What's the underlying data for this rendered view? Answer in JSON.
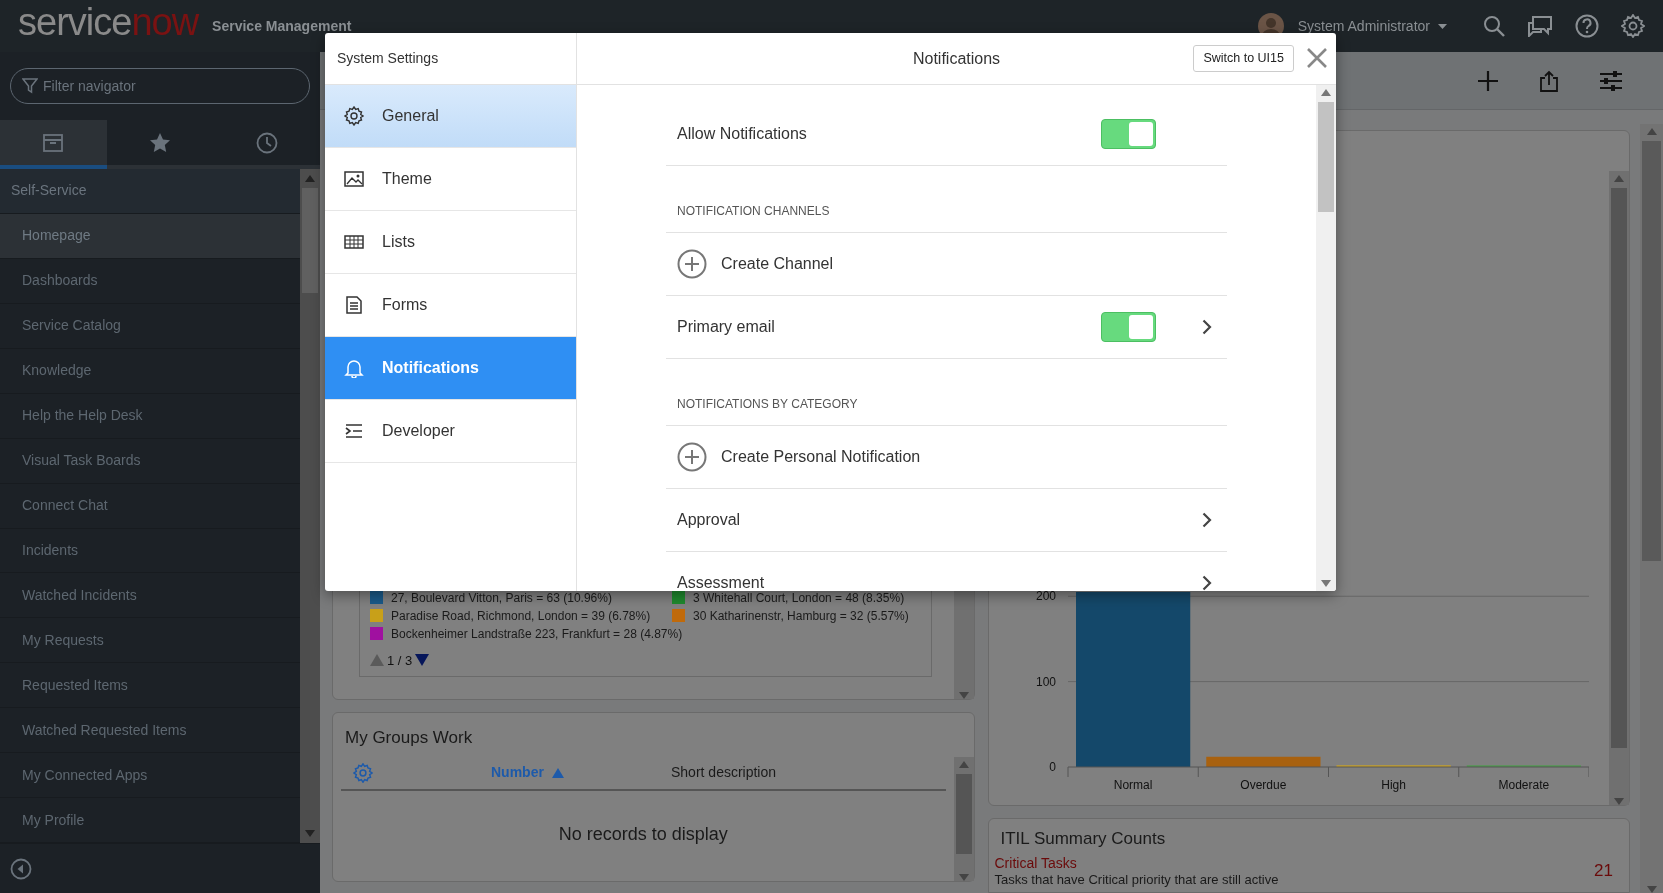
{
  "header": {
    "logo": {
      "text": "service",
      "accent": "now"
    },
    "product": "Service Management",
    "user": "System Administrator"
  },
  "navigator": {
    "filter": {
      "placeholder": "Filter navigator"
    },
    "tabs": [
      {
        "kind": "all",
        "selected": true
      },
      {
        "kind": "favorites",
        "selected": false
      },
      {
        "kind": "history",
        "selected": false
      }
    ],
    "section": "Self-Service",
    "items": [
      {
        "label": "Homepage",
        "selected": true
      },
      {
        "label": "Dashboards",
        "selected": false
      },
      {
        "label": "Service Catalog",
        "selected": false
      },
      {
        "label": "Knowledge",
        "selected": false
      },
      {
        "label": "Help the Help Desk",
        "selected": false
      },
      {
        "label": "Visual Task Boards",
        "selected": false
      },
      {
        "label": "Connect Chat",
        "selected": false
      },
      {
        "label": "Incidents",
        "selected": false
      },
      {
        "label": "Watched Incidents",
        "selected": false
      },
      {
        "label": "My Requests",
        "selected": false
      },
      {
        "label": "Requested Items",
        "selected": false
      },
      {
        "label": "Watched Requested Items",
        "selected": false
      },
      {
        "label": "My Connected Apps",
        "selected": false
      },
      {
        "label": "My Profile",
        "selected": false
      }
    ]
  },
  "legend": {
    "items": [
      {
        "label": "27, Boulevard Vitton, Paris = 63 (10.96%)",
        "color": "#1a5a8a"
      },
      {
        "label": "3 Whitehall Court, London = 48 (8.35%)",
        "color": "#1f8a2e"
      },
      {
        "label": "Paradise Road, Richmond, London = 39 (6.78%)",
        "color": "#c8a019"
      },
      {
        "label": "30 Katharinenstr, Hamburg = 32 (5.57%)",
        "color": "#c06a0b"
      },
      {
        "label": "Bockenheimer Landstraße 223, Frankfurt = 28 (4.87%)",
        "color": "#a010a0"
      }
    ],
    "pager": "1 / 3"
  },
  "groups_work": {
    "title": "My Groups Work",
    "columns": [
      {
        "label": "Number",
        "sorted": true
      },
      {
        "label": "Short description",
        "sorted": false
      }
    ],
    "empty": "No records to display"
  },
  "chart": {
    "chart_data": {
      "type": "bar",
      "categories": [
        "Normal",
        "Overdue",
        "High",
        "Moderate"
      ],
      "series": [
        {
          "color": "#14486a",
          "values": [
            205,
            null,
            null,
            null
          ]
        },
        {
          "color": "#a8610f",
          "values": [
            null,
            12,
            null,
            null
          ]
        },
        {
          "color": "#c9a227",
          "values": [
            null,
            null,
            2,
            null
          ]
        },
        {
          "color": "#4f9a4f",
          "values": [
            null,
            null,
            null,
            2
          ]
        }
      ],
      "ylim": [
        0,
        205
      ],
      "yticks": [
        0,
        100,
        200
      ]
    }
  },
  "itil": {
    "title": "ITIL Summary Counts",
    "items": [
      {
        "title": "Critical Tasks",
        "description": "Tasks that have Critical priority that are still active",
        "count": "21"
      }
    ]
  },
  "modal": {
    "sidebar_title": "System Settings",
    "title": "Notifications",
    "switch_button": "Switch to UI15",
    "nav": [
      {
        "kind": "general",
        "label": "General",
        "selected": false,
        "highlighted": true
      },
      {
        "kind": "theme",
        "label": "Theme",
        "selected": false,
        "highlighted": false
      },
      {
        "kind": "lists",
        "label": "Lists",
        "selected": false,
        "highlighted": false
      },
      {
        "kind": "forms",
        "label": "Forms",
        "selected": false,
        "highlighted": false
      },
      {
        "kind": "notifications",
        "label": "Notifications",
        "selected": true,
        "highlighted": false
      },
      {
        "kind": "developer",
        "label": "Developer",
        "selected": false,
        "highlighted": false
      }
    ],
    "rows": [
      {
        "kind": "toggle",
        "label": "Allow Notifications",
        "on": true,
        "chevron": false
      },
      {
        "kind": "section",
        "label": "NOTIFICATION CHANNELS"
      },
      {
        "kind": "create",
        "label": "Create Channel"
      },
      {
        "kind": "toggle",
        "label": "Primary email",
        "on": true,
        "chevron": true
      },
      {
        "kind": "section",
        "label": "NOTIFICATIONS BY CATEGORY"
      },
      {
        "kind": "create",
        "label": "Create Personal Notification"
      },
      {
        "kind": "link",
        "label": "Approval"
      },
      {
        "kind": "link",
        "label": "Assessment"
      }
    ]
  }
}
